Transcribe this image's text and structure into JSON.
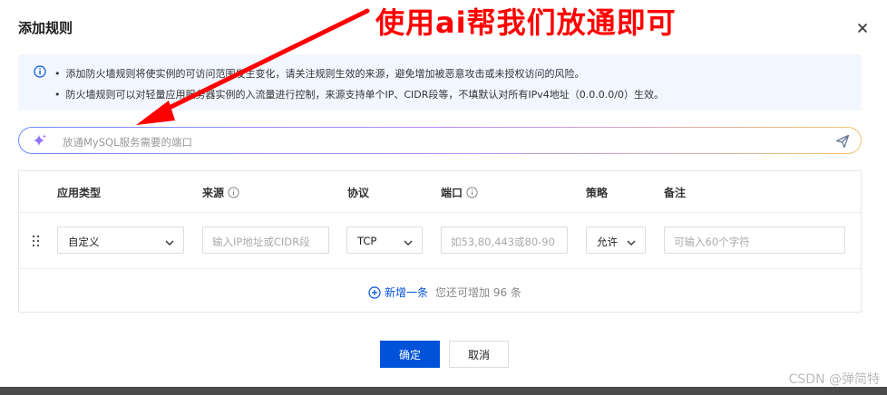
{
  "dialog": {
    "title": "添加规则"
  },
  "annotation": {
    "text": "使用ai帮我们放通即可",
    "color": "#ff0000"
  },
  "alert": {
    "line1": "添加防火墙规则将使实例的可访问范围发生变化，请关注规则生效的来源，避免增加被恶意攻击或未授权访问的风险。",
    "line2": "防火墙规则可以对轻量应用服务器实例的入流量进行控制，来源支持单个IP、CIDR段等，不填默认对所有IPv4地址（0.0.0.0/0）生效。",
    "bullet": "•",
    "icon": "info-icon"
  },
  "ai_input": {
    "placeholder": "放通MySQL服务需要的端口",
    "sparkle_icon": "sparkle-icon",
    "send_icon": "send-icon"
  },
  "table": {
    "headers": {
      "app_type": "应用类型",
      "source": "来源",
      "protocol": "协议",
      "port": "端口",
      "policy": "策略",
      "remark": "备注"
    },
    "row": {
      "app_type": "自定义",
      "source_placeholder": "输入IP地址或CIDR段",
      "protocol": "TCP",
      "port_placeholder": "如53,80,443或80-90",
      "policy": "允许",
      "remark_placeholder": "可输入60个字符"
    },
    "add_label": "新增一条",
    "remaining_text": "您还可增加 96 条"
  },
  "buttons": {
    "ok": "确定",
    "cancel": "取消"
  },
  "watermark": "CSDN @弹简特",
  "colors": {
    "primary": "#0052d9",
    "alert_bg": "#f2f6ff",
    "annotation": "#ff0000"
  }
}
